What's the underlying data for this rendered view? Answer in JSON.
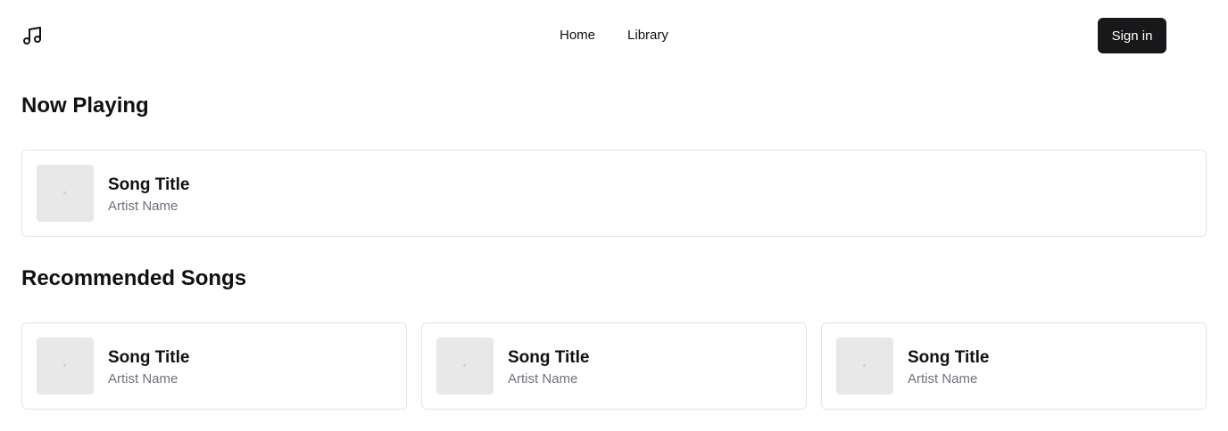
{
  "header": {
    "logo_icon": "music-note-icon",
    "nav": [
      {
        "label": "Home"
      },
      {
        "label": "Library"
      }
    ],
    "signin_label": "Sign in"
  },
  "now_playing": {
    "title": "Now Playing",
    "song": {
      "title": "Song Title",
      "artist": "Artist Name",
      "cover_icon": "album-cover-placeholder"
    }
  },
  "recommended": {
    "title": "Recommended Songs",
    "songs": [
      {
        "title": "Song Title",
        "artist": "Artist Name",
        "cover_icon": "album-cover-placeholder"
      },
      {
        "title": "Song Title",
        "artist": "Artist Name",
        "cover_icon": "album-cover-placeholder"
      },
      {
        "title": "Song Title",
        "artist": "Artist Name",
        "cover_icon": "album-cover-placeholder"
      }
    ]
  },
  "colors": {
    "button_bg": "#18181b",
    "muted_text": "#6b7280",
    "card_border": "#e5e5e5",
    "cover_bg": "#e8e8e8"
  }
}
